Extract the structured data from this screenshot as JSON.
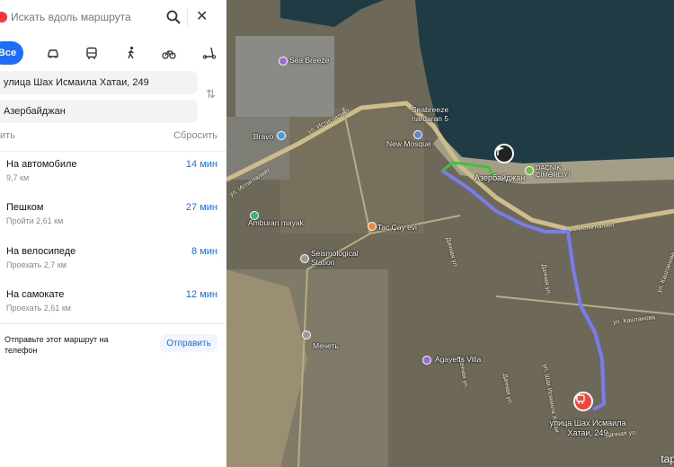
{
  "search": {
    "placeholder": "Искать вдоль маршрута"
  },
  "modes": {
    "all_label": "Все"
  },
  "points": {
    "from": "улица Шах Исмаила Хатаи, 249",
    "to": "Азербайджан"
  },
  "actions": {
    "left": "авить",
    "reset": "Сбросить"
  },
  "routes": [
    {
      "name": "На автомобиле",
      "sub": "9,7 км",
      "time": "14 мин"
    },
    {
      "name": "Пешком",
      "sub": "Пройти 2,61 км",
      "time": "27 мин"
    },
    {
      "name": "На велосипеде",
      "sub": "Проехать 2,7 км",
      "time": "8 мин"
    },
    {
      "name": "На самокате",
      "sub": "Проехать 2,61 км",
      "time": "12 мин"
    }
  ],
  "send": {
    "text": "Отправьте этот маршрут на телефон",
    "button": "Отправить"
  },
  "map": {
    "labels": {
      "sea_breeze": "Sea Breeze",
      "seabreeze_nardaran": "Seabreeze nardaran 5",
      "new_mosque": "New Mosque",
      "bravo": "Bravo",
      "dacnik": "DAÇNİK ÇİMƏRLİYİ",
      "amburan": "Amburan mayak",
      "tac_cay": "Tac Çay evi",
      "seismological": "Seismological Station",
      "mosque": "Мечеть",
      "agayeffs": "Agayeffs Villa",
      "start": "Азербайджан",
      "dest": "улица Шах Исмаила Хатаи, 249",
      "logo": "tap"
    },
    "streets": {
      "istiglaliyat_1": "ул. Истиглалият",
      "istiglaliyat_2": "ул. Истиглалият",
      "istiglaliyat_3": "ул. Истиглалият",
      "kashtanova": "ул. Каштанова",
      "kashtanova_2": "ул. Каштанова",
      "shah": "ул. Шах Исмаила Хатаи",
      "dacha_1": "Дачная ул.",
      "dacha_2": "Дачная ул.",
      "dacha_3": "Дачная ул.",
      "dacha_4": "Дачная ул.",
      "dacha_5": "Дачная ул."
    },
    "colors": {
      "route": "#7b7bf0",
      "walk": "#3cc23c",
      "accent": "#1e6cfe",
      "sea": "#1f3c44"
    }
  }
}
